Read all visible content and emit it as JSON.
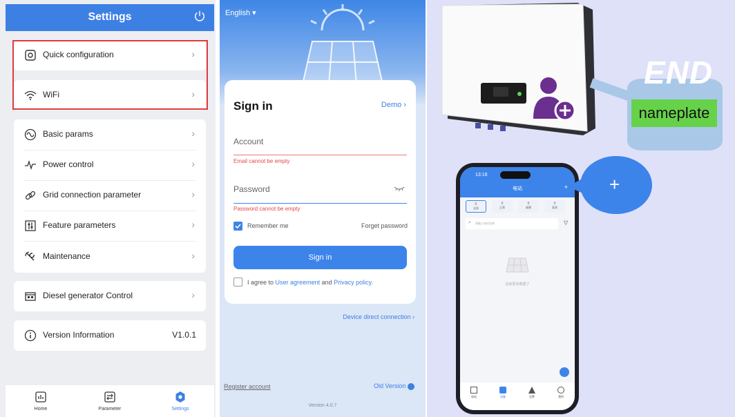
{
  "settings": {
    "header_title": "Settings",
    "groups": [
      {
        "items": [
          {
            "label": "Quick configuration",
            "icon": "gear-icon"
          },
          {
            "label": "WiFi",
            "icon": "wifi-icon"
          }
        ]
      },
      {
        "items": [
          {
            "label": "Basic params",
            "icon": "wave-icon"
          },
          {
            "label": "Power control",
            "icon": "pulse-icon"
          },
          {
            "label": "Grid connection parameter",
            "icon": "link-icon"
          },
          {
            "label": "Feature parameters",
            "icon": "sliders-icon"
          },
          {
            "label": "Maintenance",
            "icon": "wrench-icon"
          }
        ]
      },
      {
        "items": [
          {
            "label": "Diesel generator Control",
            "icon": "generator-icon"
          }
        ]
      },
      {
        "items": [
          {
            "label": "Version Information",
            "icon": "info-icon",
            "value": "V1.0.1"
          }
        ]
      }
    ],
    "tabs": [
      {
        "label": "Home",
        "icon": "home-chart-icon"
      },
      {
        "label": "Parameter",
        "icon": "parameter-icon"
      },
      {
        "label": "Settings",
        "icon": "settings-gear-icon",
        "active": true
      }
    ],
    "highlight_color": "#e03b3b",
    "accent": "#3d80e4"
  },
  "signin": {
    "language": "English",
    "title": "Sign in",
    "demo_link": "Demo",
    "account_label": "Account",
    "account_error": "Email cannot be empty",
    "password_label": "Password",
    "password_error": "Password cannot be empty",
    "remember_me": "Remember me",
    "remember_checked": true,
    "forget_password": "Forget password",
    "signin_button": "Sign in",
    "agree_prefix": "I agree to",
    "user_agreement": "User agreement",
    "agree_and": "and",
    "privacy_policy": "Privacy policy.",
    "device_direct_connection": "Device direct connection",
    "register_account": "Register account",
    "old_version": "Old Version",
    "version": "Version 4.0.7"
  },
  "device": {
    "end_label": "END",
    "nameplate_label": "nameplate",
    "phone": {
      "time": "13:18",
      "title": "电站",
      "plus": "+",
      "stats": [
        {
          "n": "0",
          "label": "全部"
        },
        {
          "n": "0",
          "label": "正常"
        },
        {
          "n": "0",
          "label": "故障"
        },
        {
          "n": "0",
          "label": "离线"
        }
      ],
      "search_placeholder": "请输入电站名称",
      "empty_text": "没有更多数据了",
      "tabs": [
        "电站",
        "设备",
        "告警",
        "我的"
      ]
    },
    "callout_plus": "+"
  }
}
